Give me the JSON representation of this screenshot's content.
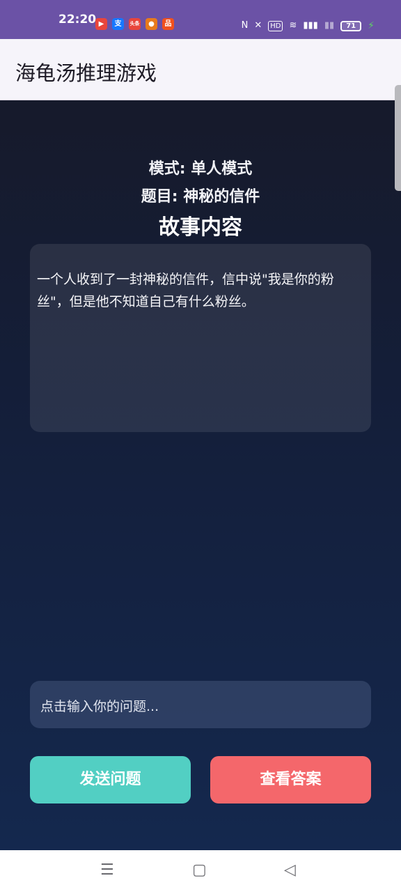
{
  "status_bar": {
    "time": "22:20",
    "apps": [
      {
        "icon": "video-app-icon",
        "glyph": "▶",
        "color": "#e8453c"
      },
      {
        "icon": "alipay-app-icon",
        "glyph": "支",
        "color": "#1677ff"
      },
      {
        "icon": "news-app-icon",
        "glyph": "头条",
        "color": "#e8453c"
      },
      {
        "icon": "weibo-app-icon",
        "glyph": "●",
        "color": "#e87a1c"
      },
      {
        "icon": "taobao-app-icon",
        "glyph": "品",
        "color": "#f0511f"
      }
    ],
    "battery": "71"
  },
  "app_bar": {
    "title": "海龟汤推理游戏"
  },
  "game": {
    "mode_text": "模式: 单人模式",
    "topic_text": "题目: 神秘的信件",
    "story_heading": "故事内容",
    "story_text": "一个人收到了一封神秘的信件，信中说\"我是你的粉丝\"，但是他不知道自己有什么粉丝。",
    "question_placeholder": "点击输入你的问题...",
    "send_button": "发送问题",
    "answer_button": "查看答案"
  },
  "colors": {
    "status_bar": "#6b52a6",
    "send_button": "#52cfc3",
    "answer_button": "#f4676b",
    "game_background": "#141f3b"
  }
}
